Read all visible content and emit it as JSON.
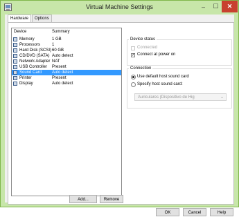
{
  "window": {
    "title": "Virtual Machine Settings",
    "controls": {
      "minimize": "–",
      "maximize": "☐",
      "close": "✕"
    }
  },
  "tabs": [
    {
      "label": "Hardware"
    },
    {
      "label": "Options"
    }
  ],
  "device_list": {
    "headers": {
      "device": "Device",
      "summary": "Summary"
    },
    "rows": [
      {
        "device": "Memory",
        "summary": "1 GB",
        "icon": "memory-icon"
      },
      {
        "device": "Processors",
        "summary": "1",
        "icon": "processor-icon"
      },
      {
        "device": "Hard Disk (SCSI)",
        "summary": "60 GB",
        "icon": "hard-disk-icon"
      },
      {
        "device": "CD/DVD (SATA)",
        "summary": "Auto detect",
        "icon": "cd-dvd-icon"
      },
      {
        "device": "Network Adapter",
        "summary": "NAT",
        "icon": "network-adapter-icon"
      },
      {
        "device": "USB Controller",
        "summary": "Present",
        "icon": "usb-controller-icon"
      },
      {
        "device": "Sound Card",
        "summary": "Auto detect",
        "icon": "sound-card-icon",
        "selected": true
      },
      {
        "device": "Printer",
        "summary": "Present",
        "icon": "printer-icon"
      },
      {
        "device": "Display",
        "summary": "Auto detect",
        "icon": "display-icon"
      }
    ],
    "add_label": "Add...",
    "remove_label": "Remove"
  },
  "device_status": {
    "legend": "Device status",
    "connected": {
      "label": "Connected",
      "checked": false,
      "enabled": false
    },
    "connect_at_power_on": {
      "label": "Connect at power on",
      "checked": true,
      "enabled": true
    }
  },
  "connection": {
    "legend": "Connection",
    "use_default": {
      "label": "Use default host sound card",
      "selected": true
    },
    "specify": {
      "label": "Specify host sound card:",
      "selected": false
    },
    "sound_card_value": "Auriculares (Dispositivo de Hig"
  },
  "footer": {
    "ok": "OK",
    "cancel": "Cancel",
    "help": "Help"
  },
  "colors": {
    "frame": "#c7e6a9",
    "selection": "#3399ff",
    "close_button": "#c8412f"
  }
}
